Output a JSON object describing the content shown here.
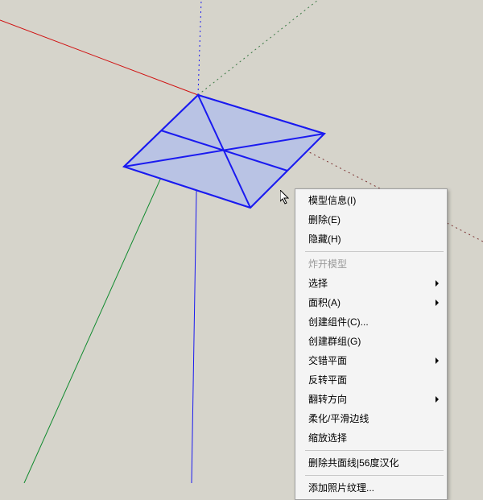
{
  "context_menu": {
    "items": [
      {
        "label": "模型信息(I)",
        "enabled": true,
        "submenu": false,
        "sep_before": false
      },
      {
        "label": "删除(E)",
        "enabled": true,
        "submenu": false,
        "sep_before": false
      },
      {
        "label": "隐藏(H)",
        "enabled": true,
        "submenu": false,
        "sep_before": false
      },
      {
        "label": "炸开模型",
        "enabled": false,
        "submenu": false,
        "sep_before": true
      },
      {
        "label": "选择",
        "enabled": true,
        "submenu": true,
        "sep_before": false
      },
      {
        "label": "面积(A)",
        "enabled": true,
        "submenu": true,
        "sep_before": false
      },
      {
        "label": "创建组件(C)...",
        "enabled": true,
        "submenu": false,
        "sep_before": false
      },
      {
        "label": "创建群组(G)",
        "enabled": true,
        "submenu": false,
        "sep_before": false
      },
      {
        "label": "交错平面",
        "enabled": true,
        "submenu": true,
        "sep_before": false
      },
      {
        "label": "反转平面",
        "enabled": true,
        "submenu": false,
        "sep_before": false
      },
      {
        "label": "翻转方向",
        "enabled": true,
        "submenu": true,
        "sep_before": false
      },
      {
        "label": "柔化/平滑边线",
        "enabled": true,
        "submenu": false,
        "sep_before": false
      },
      {
        "label": "缩放选择",
        "enabled": true,
        "submenu": false,
        "sep_before": false
      },
      {
        "label": "删除共面线|56度汉化",
        "enabled": true,
        "submenu": false,
        "sep_before": true
      },
      {
        "label": "添加照片纹理...",
        "enabled": true,
        "submenu": false,
        "sep_before": true
      }
    ]
  },
  "axes": {
    "red": "#d01010",
    "green": "#108a2e",
    "blue": "#1a1af0",
    "dotted": "#7a3030"
  },
  "selection": {
    "face_fill": "#b9c3e4",
    "edge": "#1a1af0"
  }
}
